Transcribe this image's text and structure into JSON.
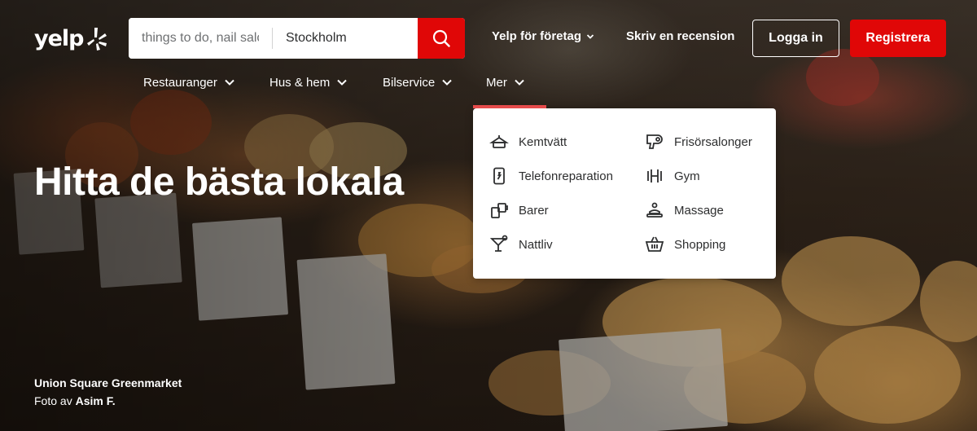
{
  "brand": {
    "logo_text": "yelp"
  },
  "search": {
    "find_placeholder": "things to do, nail salons, plumbers",
    "near_value": "Stockholm"
  },
  "header_links": {
    "business": "Yelp för företag",
    "review": "Skriv en recension",
    "login": "Logga in",
    "signup": "Registrera"
  },
  "categories": [
    {
      "label": "Restauranger"
    },
    {
      "label": "Hus & hem"
    },
    {
      "label": "Bilservice"
    },
    {
      "label": "Mer"
    }
  ],
  "more_menu": {
    "left": [
      {
        "label": "Kemtvätt",
        "icon": "dry-cleaning-icon"
      },
      {
        "label": "Telefonreparation",
        "icon": "phone-repair-icon"
      },
      {
        "label": "Barer",
        "icon": "bars-icon"
      },
      {
        "label": "Nattliv",
        "icon": "nightlife-icon"
      }
    ],
    "right": [
      {
        "label": "Frisörsalonger",
        "icon": "hair-dryer-icon"
      },
      {
        "label": "Gym",
        "icon": "gym-icon"
      },
      {
        "label": "Massage",
        "icon": "massage-icon"
      },
      {
        "label": "Shopping",
        "icon": "shopping-icon"
      }
    ]
  },
  "hero": {
    "headline": "Hitta de bästa lokala",
    "photo_title": "Union Square Greenmarket",
    "photo_by_prefix": "Foto av",
    "photo_author": "Asim F."
  },
  "colors": {
    "accent": "#e00707",
    "menu_accent": "#e64b4b"
  }
}
